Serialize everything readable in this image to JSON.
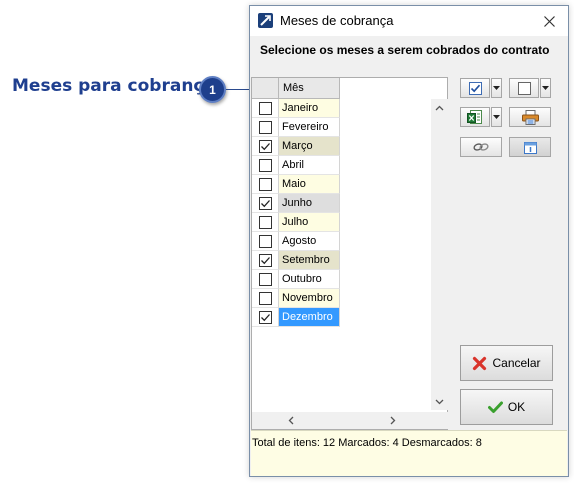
{
  "callout": {
    "label": "Meses para cobrança",
    "number": "1"
  },
  "window": {
    "title": "Meses de cobrança",
    "header": "Selecione os meses a serem cobrados do contrato"
  },
  "grid": {
    "column_header": "Mês",
    "rows": [
      {
        "month": "Janeiro",
        "checked": false
      },
      {
        "month": "Fevereiro",
        "checked": false
      },
      {
        "month": "Março",
        "checked": true
      },
      {
        "month": "Abril",
        "checked": false
      },
      {
        "month": "Maio",
        "checked": false
      },
      {
        "month": "Junho",
        "checked": true
      },
      {
        "month": "Julho",
        "checked": false
      },
      {
        "month": "Agosto",
        "checked": false
      },
      {
        "month": "Setembro",
        "checked": true
      },
      {
        "month": "Outubro",
        "checked": false
      },
      {
        "month": "Novembro",
        "checked": false
      },
      {
        "month": "Dezembro",
        "checked": true
      }
    ],
    "selected_row": "Dezembro"
  },
  "toolbar": {
    "icons": [
      "check-all-icon",
      "uncheck-all-icon",
      "excel-export-icon",
      "print-icon",
      "link-icon",
      "calendar-icon"
    ]
  },
  "buttons": {
    "cancel": "Cancelar",
    "ok": "OK"
  },
  "status": {
    "text": "Total de itens: 12 Marcados: 4 Desmarcados: 8"
  },
  "colors": {
    "accent": "#1e3f8c",
    "selection": "#3399ff",
    "status_bg": "#fefde4"
  }
}
